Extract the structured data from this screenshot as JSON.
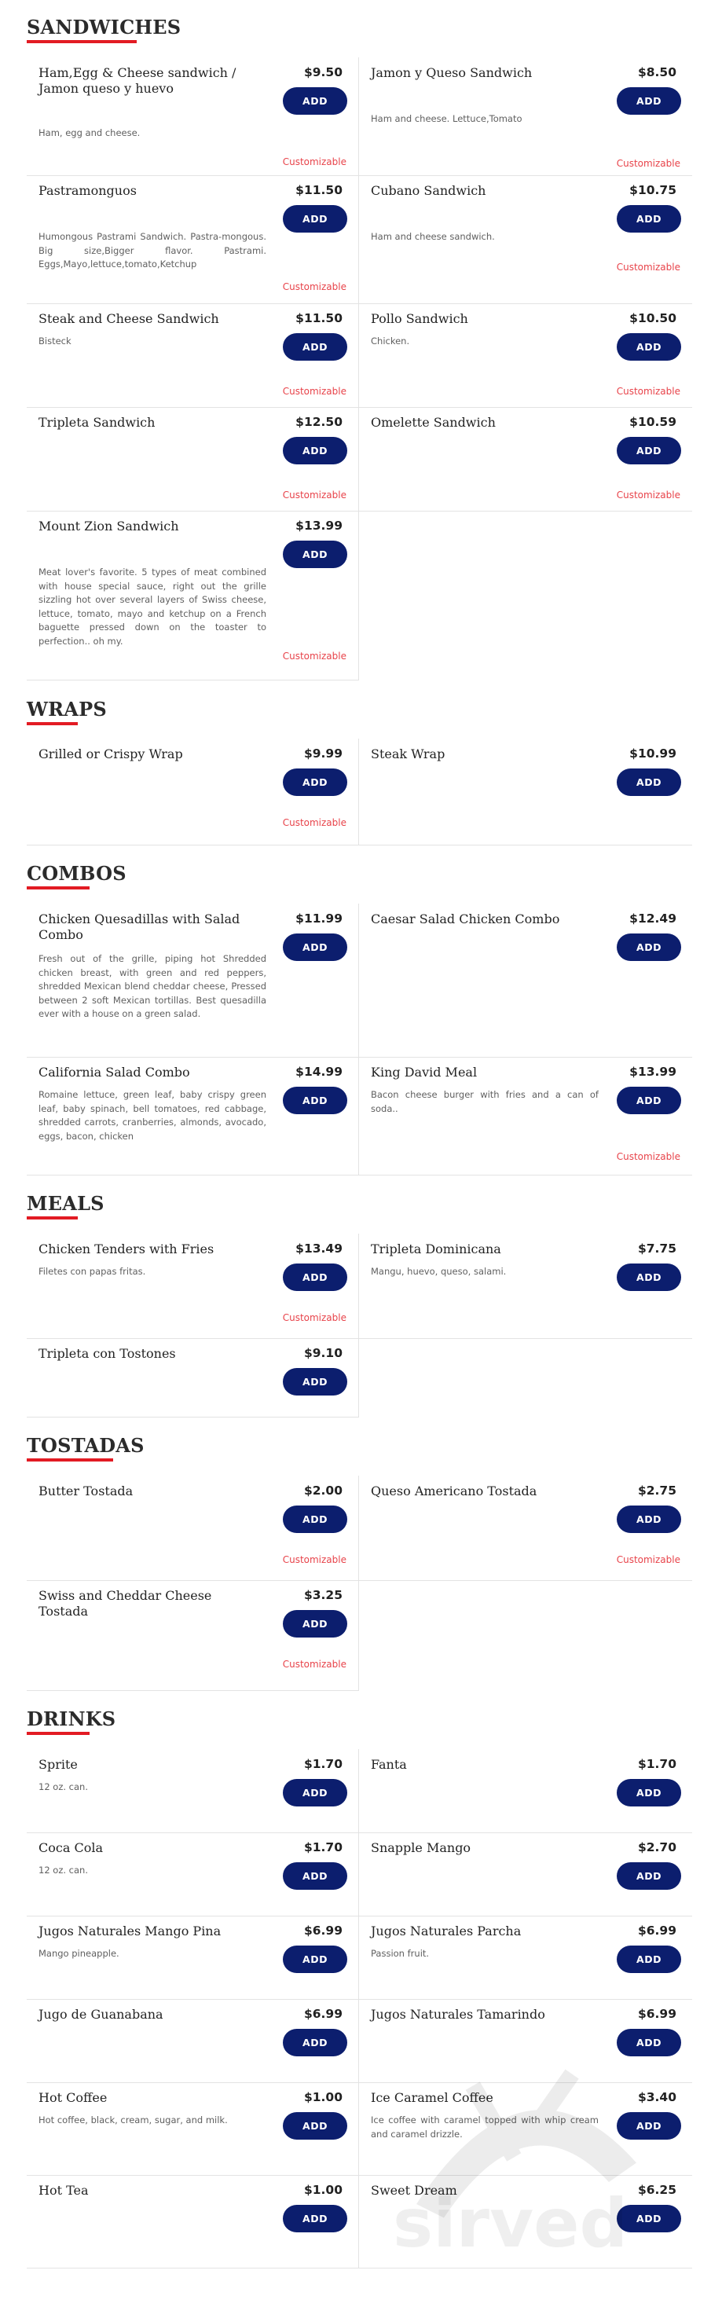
{
  "sections": [
    {
      "title": "SANDWICHES",
      "items": [
        {
          "name": "Ham,Egg & Cheese sandwich / Jamon queso y huevo",
          "price": "$9.50",
          "desc": "Ham, egg and cheese.",
          "custom": "Customizable"
        },
        {
          "name": "Jamon y Queso Sandwich",
          "price": "$8.50",
          "desc": "Ham and cheese. Lettuce,Tomato",
          "custom": "Customizable"
        },
        {
          "name": "Pastramonguos",
          "price": "$11.50",
          "desc": "Humongous Pastrami Sandwich. Pastra-mongous. Big size,Bigger flavor. Pastrami. Eggs,Mayo,lettuce,tomato,Ketchup",
          "custom": "Customizable"
        },
        {
          "name": "Cubano Sandwich",
          "price": "$10.75",
          "desc": "Ham and cheese sandwich.",
          "custom": "Customizable"
        },
        {
          "name": "Steak and Cheese Sandwich",
          "price": "$11.50",
          "desc": "Bisteck",
          "custom": "Customizable"
        },
        {
          "name": "Pollo Sandwich",
          "price": "$10.50",
          "desc": "Chicken.",
          "custom": "Customizable"
        },
        {
          "name": "Tripleta Sandwich",
          "price": "$12.50",
          "desc": "",
          "custom": "Customizable"
        },
        {
          "name": "Omelette Sandwich",
          "price": "$10.59",
          "desc": "",
          "custom": "Customizable"
        },
        {
          "name": "Mount Zion Sandwich",
          "price": "$13.99",
          "desc": "Meat lover's favorite. 5 types of meat combined with house special sauce, right out the grille sizzling hot over several layers of Swiss cheese, lettuce, tomato, mayo and ketchup on a French baguette pressed down on the toaster to perfection.. oh my.",
          "custom": "Customizable"
        }
      ]
    },
    {
      "title": "WRAPS",
      "items": [
        {
          "name": "Grilled or Crispy Wrap",
          "price": "$9.99",
          "desc": "",
          "custom": "Customizable"
        },
        {
          "name": "Steak Wrap",
          "price": "$10.99",
          "desc": "",
          "custom": ""
        }
      ]
    },
    {
      "title": "COMBOS",
      "items": [
        {
          "name": "Chicken Quesadillas with Salad Combo",
          "price": "$11.99",
          "desc": "Fresh out of the grille, piping hot Shredded chicken breast, with green and red peppers, shredded Mexican blend cheddar cheese, Pressed between 2 soft Mexican tortillas. Best quesadilla ever with a house on a green salad.",
          "custom": ""
        },
        {
          "name": "Caesar Salad Chicken Combo",
          "price": "$12.49",
          "desc": "",
          "custom": ""
        },
        {
          "name": "California Salad Combo",
          "price": "$14.99",
          "desc": "Romaine lettuce, green leaf, baby crispy green leaf, baby spinach, bell tomatoes, red cabbage, shredded carrots, cranberries, almonds, avocado, eggs, bacon, chicken",
          "custom": ""
        },
        {
          "name": "King David Meal",
          "price": "$13.99",
          "desc": "Bacon cheese burger with fries and a can of soda..",
          "custom": "Customizable"
        }
      ]
    },
    {
      "title": "MEALS",
      "items": [
        {
          "name": "Chicken Tenders with Fries",
          "price": "$13.49",
          "desc": "Filetes con papas fritas.",
          "custom": "Customizable"
        },
        {
          "name": "Tripleta Dominicana",
          "price": "$7.75",
          "desc": "Mangu, huevo, queso, salami.",
          "custom": ""
        },
        {
          "name": "Tripleta con Tostones",
          "price": "$9.10",
          "desc": "",
          "custom": ""
        }
      ]
    },
    {
      "title": "TOSTADAS",
      "items": [
        {
          "name": "Butter Tostada",
          "price": "$2.00",
          "desc": "",
          "custom": "Customizable"
        },
        {
          "name": "Queso Americano Tostada",
          "price": "$2.75",
          "desc": "",
          "custom": "Customizable"
        },
        {
          "name": "Swiss and Cheddar Cheese Tostada",
          "price": "$3.25",
          "desc": "",
          "custom": "Customizable"
        }
      ]
    },
    {
      "title": "DRINKS",
      "items": [
        {
          "name": "Sprite",
          "price": "$1.70",
          "desc": "12 oz. can.",
          "custom": ""
        },
        {
          "name": "Fanta",
          "price": "$1.70",
          "desc": "",
          "custom": ""
        },
        {
          "name": "Coca Cola",
          "price": "$1.70",
          "desc": "12 oz. can.",
          "custom": ""
        },
        {
          "name": "Snapple Mango",
          "price": "$2.70",
          "desc": "",
          "custom": ""
        },
        {
          "name": "Jugos Naturales Mango Pina",
          "price": "$6.99",
          "desc": "Mango pineapple.",
          "custom": ""
        },
        {
          "name": "Jugos Naturales Parcha",
          "price": "$6.99",
          "desc": "Passion fruit.",
          "custom": ""
        },
        {
          "name": "Jugo de Guanabana",
          "price": "$6.99",
          "desc": "",
          "custom": ""
        },
        {
          "name": "Jugos Naturales Tamarindo",
          "price": "$6.99",
          "desc": "",
          "custom": ""
        },
        {
          "name": "Hot Coffee",
          "price": "$1.00",
          "desc": "Hot coffee, black, cream, sugar, and milk.",
          "custom": ""
        },
        {
          "name": "Ice Caramel Coffee",
          "price": "$3.40",
          "desc": "Ice coffee with caramel topped with whip cream and caramel drizzle.",
          "custom": ""
        },
        {
          "name": "Hot Tea",
          "price": "$1.00",
          "desc": "",
          "custom": ""
        },
        {
          "name": "Sweet Dream",
          "price": "$6.25",
          "desc": "",
          "custom": ""
        }
      ]
    }
  ],
  "add_label": "ADD",
  "watermark": "sirved",
  "colors": {
    "accent": "#e21b23",
    "button": "#0c1e6e",
    "customizable": "#e8434a"
  }
}
